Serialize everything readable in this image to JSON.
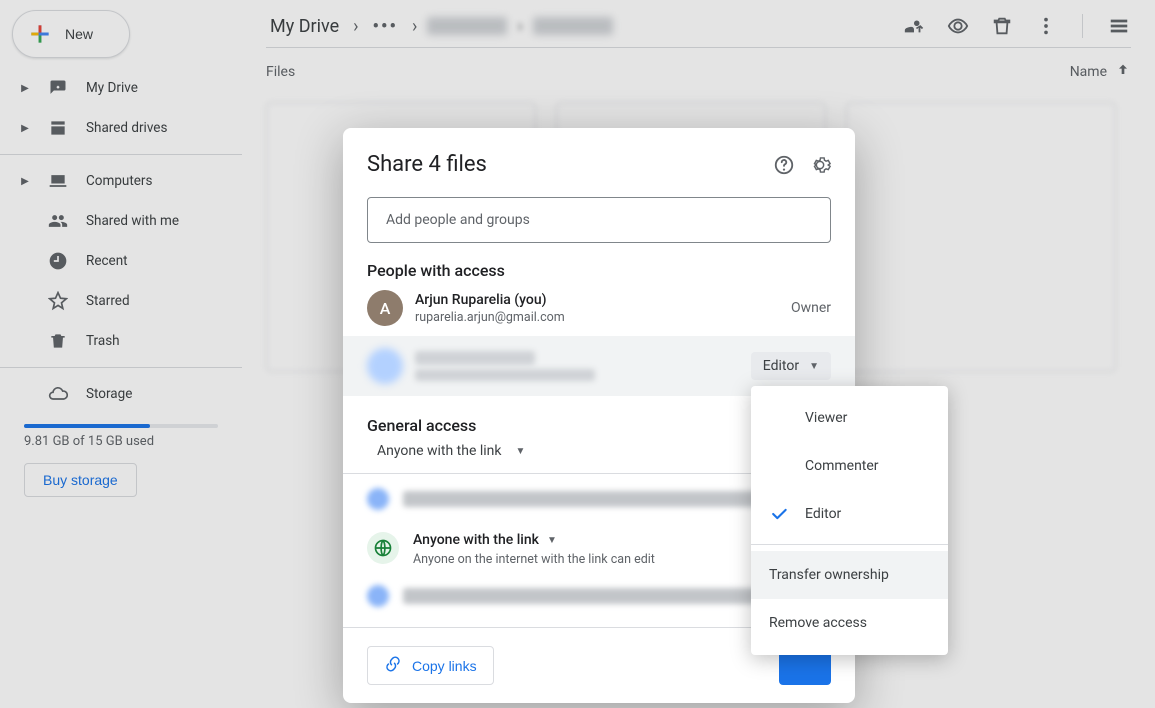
{
  "sidebar": {
    "new_label": "New",
    "items": [
      {
        "label": "My Drive",
        "chevron": true
      },
      {
        "label": "Shared drives",
        "chevron": true
      },
      {
        "label": "Computers",
        "chevron": true
      },
      {
        "label": "Shared with me",
        "chevron": false
      },
      {
        "label": "Recent",
        "chevron": false
      },
      {
        "label": "Starred",
        "chevron": false
      },
      {
        "label": "Trash",
        "chevron": false
      },
      {
        "label": "Storage",
        "chevron": false
      }
    ],
    "storage_used_pct": 65,
    "storage_text": "9.81 GB of 15 GB used",
    "buy_label": "Buy storage"
  },
  "breadcrumb": {
    "root": "My Drive"
  },
  "files_header": {
    "left": "Files",
    "sort": "Name"
  },
  "dialog": {
    "title": "Share 4 files",
    "add_placeholder": "Add people and groups",
    "section_people": "People with access",
    "owner": {
      "name": "Arjun Ruparelia (you)",
      "email": "ruparelia.arjun@gmail.com",
      "role": "Owner",
      "initial": "A"
    },
    "editor_role_button": "Editor",
    "section_general": "General access",
    "general_dropdown": "Anyone with the link",
    "link": {
      "title": "Anyone with the link",
      "desc": "Anyone on the internet with the link can edit"
    },
    "copy_label": "Copy links"
  },
  "role_menu": {
    "viewer": "Viewer",
    "commenter": "Commenter",
    "editor": "Editor",
    "transfer": "Transfer ownership",
    "remove": "Remove access",
    "selected": "editor"
  }
}
